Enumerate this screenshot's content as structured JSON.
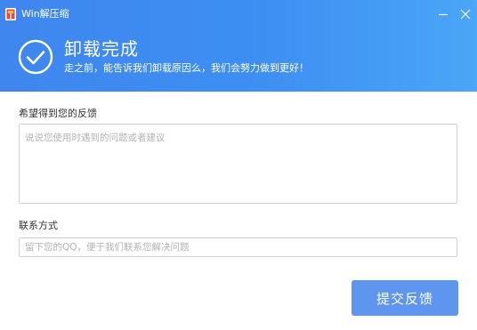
{
  "window": {
    "title": "Win解压缩",
    "app_icon": "archive-app-icon",
    "controls": {
      "minimize_icon": "minimize-icon",
      "close_icon": "close-icon"
    }
  },
  "header": {
    "status_icon": "checkmark-circle-icon",
    "title": "卸载完成",
    "subtitle": "走之前，能告诉我们卸载原因么，我们会努力做到更好！"
  },
  "form": {
    "feedback_label": "希望得到您的反馈",
    "feedback_placeholder": "说说您使用时遇到的问题或者建议",
    "feedback_value": "",
    "contact_label": "联系方式",
    "contact_placeholder": "留下您的QQ，便于我们联系您解决问题",
    "contact_value": "",
    "submit_label": "提交反馈"
  },
  "colors": {
    "header_gradient_start": "#3f86ef",
    "header_gradient_end": "#4aa6f7",
    "button_bg": "#5e95ef",
    "input_border": "#cfd3d9"
  }
}
